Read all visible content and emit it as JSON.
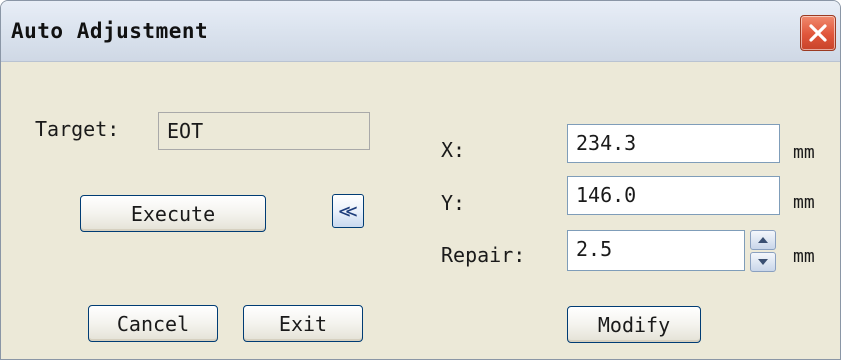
{
  "window": {
    "title": "Auto Adjustment",
    "close_icon": "close-icon"
  },
  "target": {
    "label": "Target:",
    "value": "EOT"
  },
  "buttons": {
    "execute": "Execute",
    "collapse": "<<",
    "cancel": "Cancel",
    "exit": "Exit",
    "modify": "Modify"
  },
  "coords": {
    "x_label": "X:",
    "x_value": "234.3",
    "y_label": "Y:",
    "y_value": "146.0",
    "repair_label": "Repair:",
    "repair_value": "2.5",
    "unit": "mm"
  },
  "colors": {
    "dialog_bg": "#ece9d8",
    "close_button": "#e0553a",
    "button_border": "#003c74"
  }
}
